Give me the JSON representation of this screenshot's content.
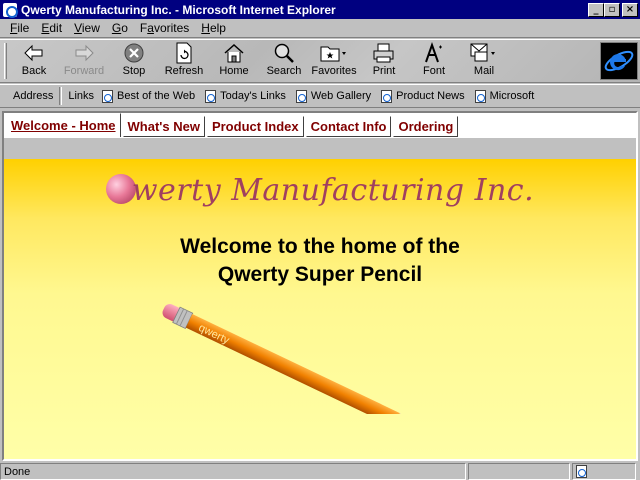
{
  "window": {
    "title": "Qwerty Manufacturing Inc. - Microsoft Internet Explorer",
    "minimize": "_",
    "maximize": "▫",
    "close": "×"
  },
  "menu": [
    {
      "pre": "",
      "u": "F",
      "post": "ile"
    },
    {
      "pre": "",
      "u": "E",
      "post": "dit"
    },
    {
      "pre": "",
      "u": "V",
      "post": "iew"
    },
    {
      "pre": "",
      "u": "G",
      "post": "o"
    },
    {
      "pre": "F",
      "u": "a",
      "post": "vorites"
    },
    {
      "pre": "",
      "u": "H",
      "post": "elp"
    }
  ],
  "toolbar": {
    "back": "Back",
    "forward": "Forward",
    "stop": "Stop",
    "refresh": "Refresh",
    "home": "Home",
    "search": "Search",
    "favorites": "Favorites",
    "print": "Print",
    "font": "Font",
    "mail": "Mail"
  },
  "linksbar": {
    "address_label": "Address",
    "links_label": "Links",
    "links": [
      "Best of the Web",
      "Today's Links",
      "Web Gallery",
      "Product News",
      "Microsoft"
    ]
  },
  "tabs": [
    {
      "label": "Welcome - Home",
      "active": true
    },
    {
      "label": "What's New"
    },
    {
      "label": "Product Index"
    },
    {
      "label": "Contact Info"
    },
    {
      "label": "Ordering"
    }
  ],
  "page": {
    "company_rest": "werty Manufacturing Inc.",
    "welcome_line1": "Welcome to the home of the",
    "welcome_line2": "Qwerty Super Pencil",
    "pencil_text": "qwerty"
  },
  "status": {
    "text": "Done"
  },
  "colors": {
    "title_bar": "#000080",
    "tab_text": "#800000",
    "page_gradient_top": "#ffd000",
    "page_gradient_bottom": "#ffffa8",
    "company_text": "#a04060"
  }
}
